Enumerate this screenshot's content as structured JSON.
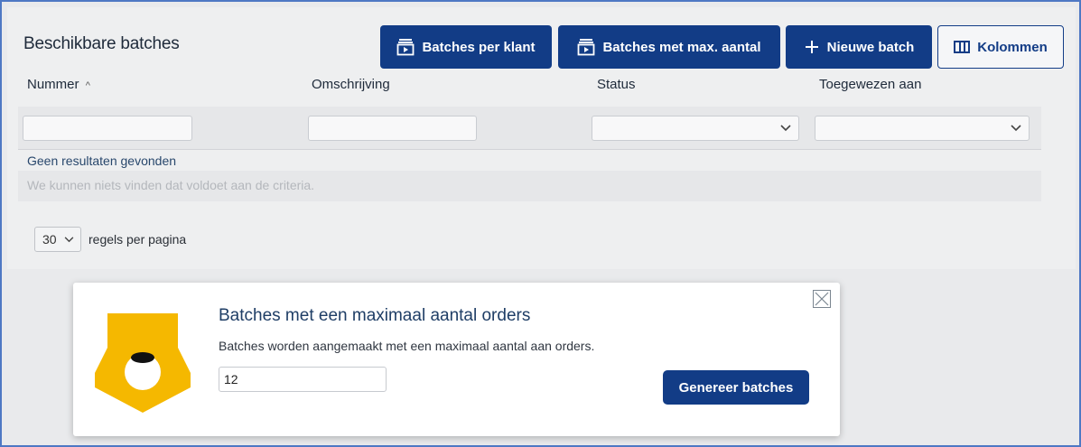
{
  "panel": {
    "title": "Beschikbare batches",
    "buttons": {
      "per_klant": "Batches per klant",
      "max_aantal": "Batches met max. aantal",
      "nieuwe_batch": "Nieuwe batch",
      "kolommen": "Kolommen"
    },
    "columns": [
      "Nummer",
      "Omschrijving",
      "Status",
      "Toegewezen aan"
    ],
    "sort_indicator": "^",
    "filters": {
      "nummer": "",
      "omschrijving": "",
      "status": "",
      "toegewezen_aan": ""
    },
    "empty_title": "Geen resultaten gevonden",
    "empty_text": "We kunnen niets vinden dat voldoet aan de criteria.",
    "per_page_value": "30",
    "per_page_label": "regels per pagina"
  },
  "modal": {
    "title": "Batches met een maximaal aantal orders",
    "description": "Batches worden aangemaakt met een maximaal aantal aan orders.",
    "input_value": "12",
    "button_label": "Genereer batches"
  },
  "colors": {
    "primary": "#123c86",
    "logo_yellow": "#f5b800"
  },
  "icons": {
    "batch_icon": "play-stack-icon",
    "plus_icon": "plus-icon",
    "columns_icon": "columns-icon",
    "chevron_icon": "chevron-down-icon",
    "close_icon": "close-icon",
    "logo": "brand-logo"
  }
}
